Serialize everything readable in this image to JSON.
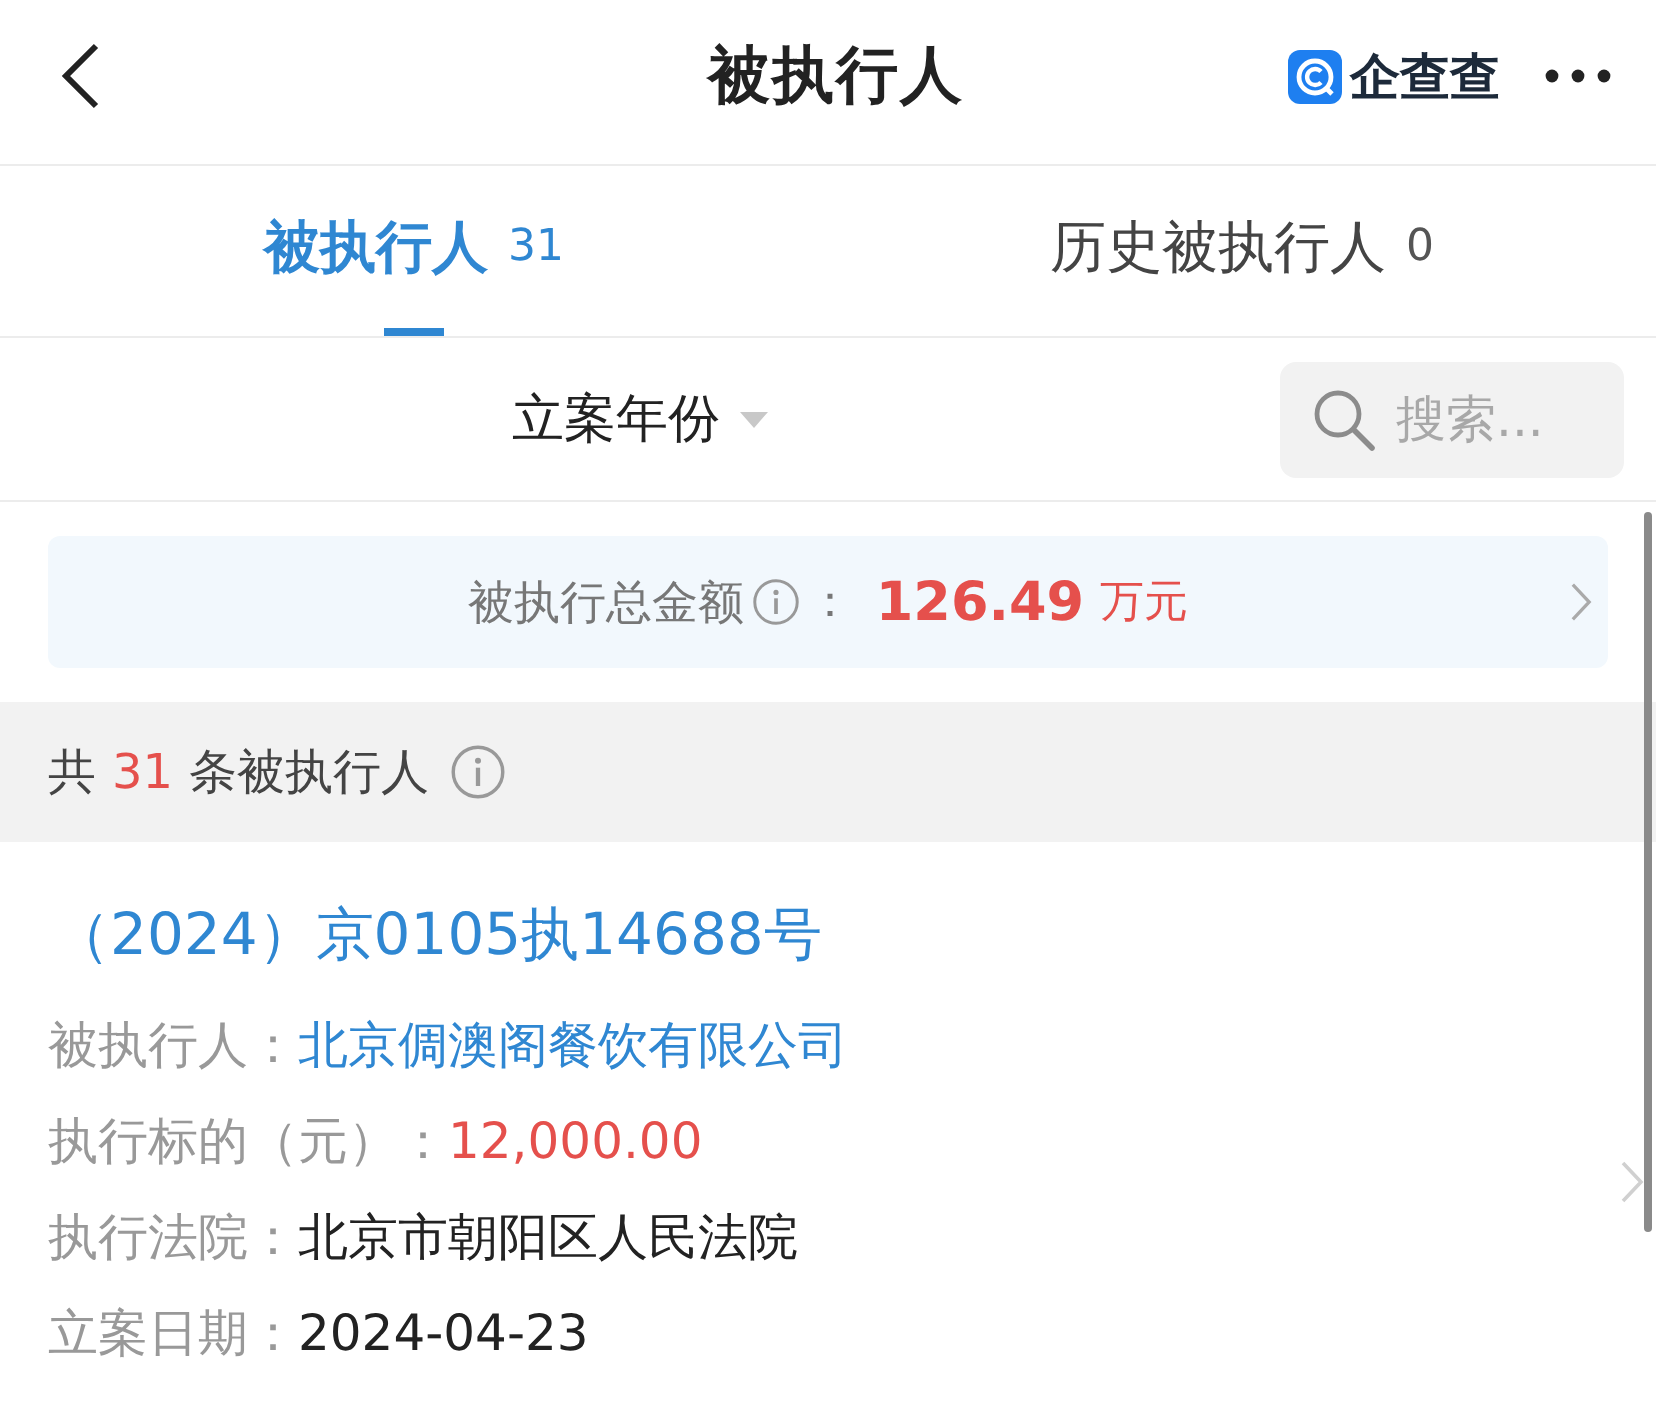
{
  "header": {
    "title": "被执行人",
    "brand": "企查查"
  },
  "tabs": [
    {
      "label": "被执行人",
      "count": "31",
      "selected": true
    },
    {
      "label": "历史被执行人",
      "count": "0",
      "selected": false
    }
  ],
  "filter": {
    "label": "立案年份"
  },
  "search": {
    "placeholder": "搜索..."
  },
  "summary": {
    "label": "被执行总金额",
    "separator": "：",
    "amount": "126.49",
    "unit": "万元"
  },
  "count_bar": {
    "prefix": "共",
    "count": "31",
    "suffix": "条被执行人"
  },
  "records": [
    {
      "title": "（2024）京0105执14688号",
      "fields": [
        {
          "label": "被执行人：",
          "value": "北京倜澳阁餐饮有限公司",
          "kind": "link"
        },
        {
          "label": "执行标的（元）：",
          "value": "12,000.00",
          "kind": "amount"
        },
        {
          "label": "执行法院：",
          "value": "北京市朝阳区人民法院",
          "kind": "plain"
        },
        {
          "label": "立案日期：",
          "value": "2024-04-23",
          "kind": "plain"
        }
      ]
    }
  ]
}
